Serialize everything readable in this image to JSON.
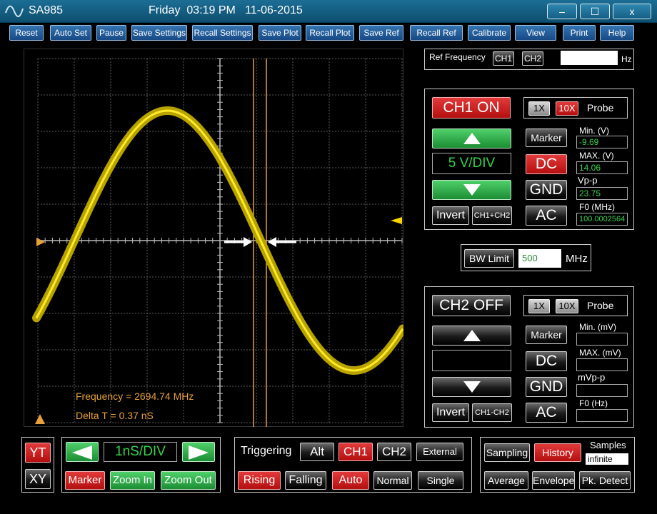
{
  "window": {
    "app_name": "SA985",
    "datetime": "Friday  03:19 PM   11-06-2015",
    "minimize_label": "–",
    "maximize_label": "☐",
    "close_label": "x"
  },
  "toolbar": [
    {
      "name": "reset-button",
      "label": "Reset"
    },
    {
      "name": "auto-set-button",
      "label": "Auto Set"
    },
    {
      "name": "pause-button",
      "label": "Pause"
    },
    {
      "name": "save-settings-button",
      "label": "Save Settings"
    },
    {
      "name": "recall-settings-button",
      "label": "Recall Settings"
    },
    {
      "name": "save-plot-button",
      "label": "Save Plot"
    },
    {
      "name": "recall-plot-button",
      "label": "Recall Plot"
    },
    {
      "name": "save-ref-button",
      "label": "Save Ref"
    },
    {
      "name": "recall-ref-button",
      "label": "Recall Ref"
    },
    {
      "name": "calibrate-button",
      "label": "Calibrate"
    },
    {
      "name": "view-button",
      "label": "View"
    },
    {
      "name": "print-button",
      "label": "Print"
    },
    {
      "name": "help-button",
      "label": "Help"
    }
  ],
  "scope": {
    "frequency_text": "Frequency = 2694.74 MHz",
    "delta_t_text": "Delta T = 0.37 nS",
    "trace_color": "#ffe81a",
    "marker_color": "#e8a038"
  },
  "ref_frequency": {
    "label": "Ref Frequency",
    "ch1": "CH1",
    "ch2": "CH2",
    "value": "",
    "unit": "Hz"
  },
  "ch1": {
    "state": "CH1 ON",
    "probe_1x": "1X",
    "probe_10x": "10X",
    "probe_label": "Probe",
    "volts_div": "5 V/DIV",
    "marker": "Marker",
    "dc": "DC",
    "gnd": "GND",
    "ac": "AC",
    "invert": "Invert",
    "math": "CH1+CH2",
    "min_label": "Min. (V)",
    "min_value": "-9.69",
    "max_label": "MAX. (V)",
    "max_value": "14.06",
    "vpp_label": "Vp-p",
    "vpp_value": "23.75",
    "f0_label": "F0 (MHz)",
    "f0_value": "100.0002564"
  },
  "bw_limit": {
    "button": "BW Limit",
    "value": "500",
    "unit": "MHz"
  },
  "ch2": {
    "state": "CH2 OFF",
    "probe_1x": "1X",
    "probe_10x": "10X",
    "probe_label": "Probe",
    "volts_div": "",
    "marker": "Marker",
    "dc": "DC",
    "gnd": "GND",
    "ac": "AC",
    "invert": "Invert",
    "math": "CH1-CH2",
    "min_label": "Min. (mV)",
    "min_value": "",
    "max_label": "MAX. (mV)",
    "max_value": "",
    "vpp_label": "mVp-p",
    "vpp_value": "",
    "f0_label": "F0 (Hz)",
    "f0_value": ""
  },
  "mode": {
    "yt": "YT",
    "xy": "XY"
  },
  "timebase": {
    "value": "1nS/DIV",
    "marker": "Marker",
    "zoom_in": "Zoom In",
    "zoom_out": "Zoom Out"
  },
  "triggering": {
    "label": "Triggering",
    "alt": "Alt",
    "ch1": "CH1",
    "ch2": "CH2",
    "external": "External",
    "rising": "Rising",
    "falling": "Falling",
    "auto": "Auto",
    "normal": "Normal",
    "single": "Single"
  },
  "acquisition": {
    "sampling": "Sampling",
    "history": "History",
    "samples_label": "Samples",
    "samples_value": "infinite",
    "average": "Average",
    "envelope": "Envelope",
    "pk_detect": "Pk. Detect"
  }
}
